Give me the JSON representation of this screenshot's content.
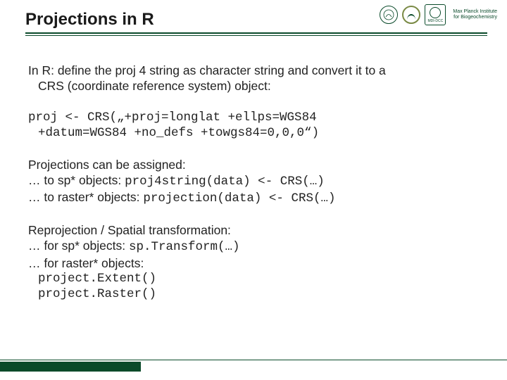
{
  "header": {
    "title": "Projections in R",
    "logo_box_label": "MDI-DCC",
    "logo_text_line1": "Max Planck Institute",
    "logo_text_line2": "for Biogeochemistry"
  },
  "body": {
    "intro_l1": "In R: define the proj 4 string as character string and convert it to a",
    "intro_l2": "CRS (coordinate reference system) object:",
    "code1_l1": "proj <- CRS(„+proj=longlat +ellps=WGS84",
    "code1_l2": "+datum=WGS84 +no_defs +towgs84=0,0,0“)",
    "assign_head": "Projections can be assigned:",
    "assign_sp_pre": "… to sp* objects: ",
    "assign_sp_code": "proj4string(data) <- CRS(…)",
    "assign_raster_pre": "… to raster* objects: ",
    "assign_raster_code": "projection(data) <- CRS(…)",
    "reproj_head": "Reprojection / Spatial transformation:",
    "reproj_sp_pre": "… for sp* objects: ",
    "reproj_sp_code": "sp.Transform(…)",
    "reproj_raster_pre": "… for raster* objects:",
    "reproj_code_a": "project.Extent()",
    "reproj_code_b": "project.Raster()"
  }
}
